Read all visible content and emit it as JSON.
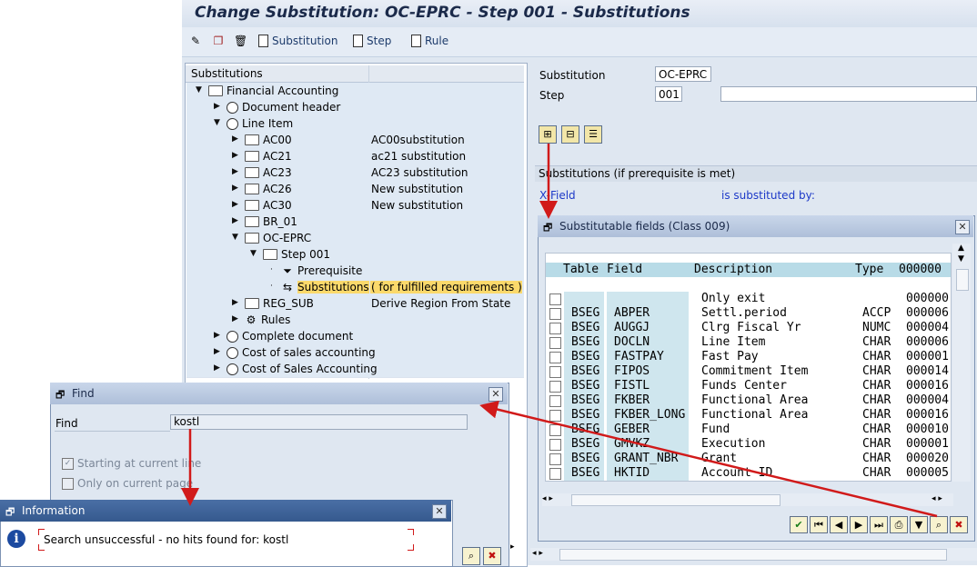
{
  "window": {
    "title": "Change Substitution: OC-EPRC - Step 001 - Substitutions"
  },
  "toolbar": {
    "buttons": [
      {
        "label": "Substitution",
        "icon": "document-icon"
      },
      {
        "label": "Step",
        "icon": "document-icon"
      },
      {
        "label": "Rule",
        "icon": "document-icon"
      }
    ]
  },
  "tree": {
    "header": "Substitutions",
    "rows": [
      {
        "label": "Financial Accounting",
        "desc": "",
        "icon": "folder-open-icon",
        "level": 0,
        "expanded": true
      },
      {
        "label": "Document header",
        "desc": "",
        "icon": "clock-icon",
        "level": 1,
        "expanded": false
      },
      {
        "label": "Line Item",
        "desc": "",
        "icon": "clock-icon",
        "level": 1,
        "expanded": true
      },
      {
        "label": "AC00",
        "desc": "AC00substitution",
        "icon": "folder-icon",
        "level": 2,
        "expanded": false
      },
      {
        "label": "AC21",
        "desc": "ac21 substitution",
        "icon": "folder-icon",
        "level": 2,
        "expanded": false
      },
      {
        "label": "AC23",
        "desc": "AC23 substitution",
        "icon": "folder-icon",
        "level": 2,
        "expanded": false
      },
      {
        "label": "AC26",
        "desc": "New substitution",
        "icon": "folder-icon",
        "level": 2,
        "expanded": false
      },
      {
        "label": "AC30",
        "desc": "New substitution",
        "icon": "folder-icon",
        "level": 2,
        "expanded": false
      },
      {
        "label": "BR_01",
        "desc": "",
        "icon": "folder-icon",
        "level": 2,
        "expanded": false
      },
      {
        "label": "OC-EPRC",
        "desc": "",
        "icon": "folder-open-icon",
        "level": 2,
        "expanded": true
      },
      {
        "label": "Step 001",
        "desc": "",
        "icon": "folder-open-icon",
        "level": 3,
        "expanded": true
      },
      {
        "label": "Prerequisite",
        "desc": "",
        "icon": "funnel-icon",
        "level": 4,
        "expanded": null
      },
      {
        "label": "Substitutions",
        "desc": "( for fulfilled requirements )",
        "icon": "substitution-icon",
        "level": 4,
        "expanded": null,
        "selected": true
      },
      {
        "label": "REG_SUB",
        "desc": "Derive Region From State",
        "icon": "folder-icon",
        "level": 2,
        "expanded": false
      },
      {
        "label": "Rules",
        "desc": "",
        "icon": "rules-icon",
        "level": 2,
        "expanded": false
      },
      {
        "label": "Complete document",
        "desc": "",
        "icon": "clock-icon",
        "level": 1,
        "expanded": false
      },
      {
        "label": "Cost of sales accounting",
        "desc": "",
        "icon": "clock-icon",
        "level": 1,
        "expanded": false
      },
      {
        "label": "Cost of Sales Accounting",
        "desc": "",
        "icon": "clock-icon",
        "level": 1,
        "expanded": false
      }
    ]
  },
  "detail": {
    "substitution_label": "Substitution",
    "substitution_value": "OC-EPRC",
    "step_label": "Step",
    "step_value": "001",
    "step_desc": "",
    "section_title": "Substitutions (if prerequisite is met)",
    "field_link": "X-Field",
    "substituted_by": "is substituted by:"
  },
  "popup_fields": {
    "title": "Substitutable fields (Class 009)",
    "columns": [
      "Table",
      "Field",
      "Description",
      "Type",
      "000000"
    ],
    "rows": [
      {
        "table": "",
        "field": "",
        "description": "Only exit",
        "type": "",
        "len": "000000"
      },
      {
        "table": "BSEG",
        "field": "ABPER",
        "description": "Settl.period",
        "type": "ACCP",
        "len": "000006"
      },
      {
        "table": "BSEG",
        "field": "AUGGJ",
        "description": "Clrg Fiscal Yr",
        "type": "NUMC",
        "len": "000004"
      },
      {
        "table": "BSEG",
        "field": "DOCLN",
        "description": "Line Item",
        "type": "CHAR",
        "len": "000006"
      },
      {
        "table": "BSEG",
        "field": "FASTPAY",
        "description": "Fast Pay",
        "type": "CHAR",
        "len": "000001"
      },
      {
        "table": "BSEG",
        "field": "FIPOS",
        "description": "Commitment Item",
        "type": "CHAR",
        "len": "000014"
      },
      {
        "table": "BSEG",
        "field": "FISTL",
        "description": "Funds Center",
        "type": "CHAR",
        "len": "000016"
      },
      {
        "table": "BSEG",
        "field": "FKBER",
        "description": "Functional Area",
        "type": "CHAR",
        "len": "000004"
      },
      {
        "table": "BSEG",
        "field": "FKBER_LONG",
        "description": "Functional Area",
        "type": "CHAR",
        "len": "000016"
      },
      {
        "table": "BSEG",
        "field": "GEBER",
        "description": "Fund",
        "type": "CHAR",
        "len": "000010"
      },
      {
        "table": "BSEG",
        "field": "GMVKZ",
        "description": "Execution",
        "type": "CHAR",
        "len": "000001"
      },
      {
        "table": "BSEG",
        "field": "GRANT_NBR",
        "description": "Grant",
        "type": "CHAR",
        "len": "000020"
      },
      {
        "table": "BSEG",
        "field": "HKTID",
        "description": "Account ID",
        "type": "CHAR",
        "len": "000005"
      }
    ]
  },
  "find_dialog": {
    "title": "Find",
    "find_label": "Find",
    "find_value": "kostl",
    "opt_current_line": "Starting at current line",
    "opt_current_page": "Only on current page"
  },
  "info_dialog": {
    "title": "Information",
    "message": "Search unsuccessful - no hits found for: kostl"
  },
  "colors": {
    "arrow": "#d11a1a",
    "selected_row": "#fbd96b",
    "title_text": "#1b2a4a"
  }
}
